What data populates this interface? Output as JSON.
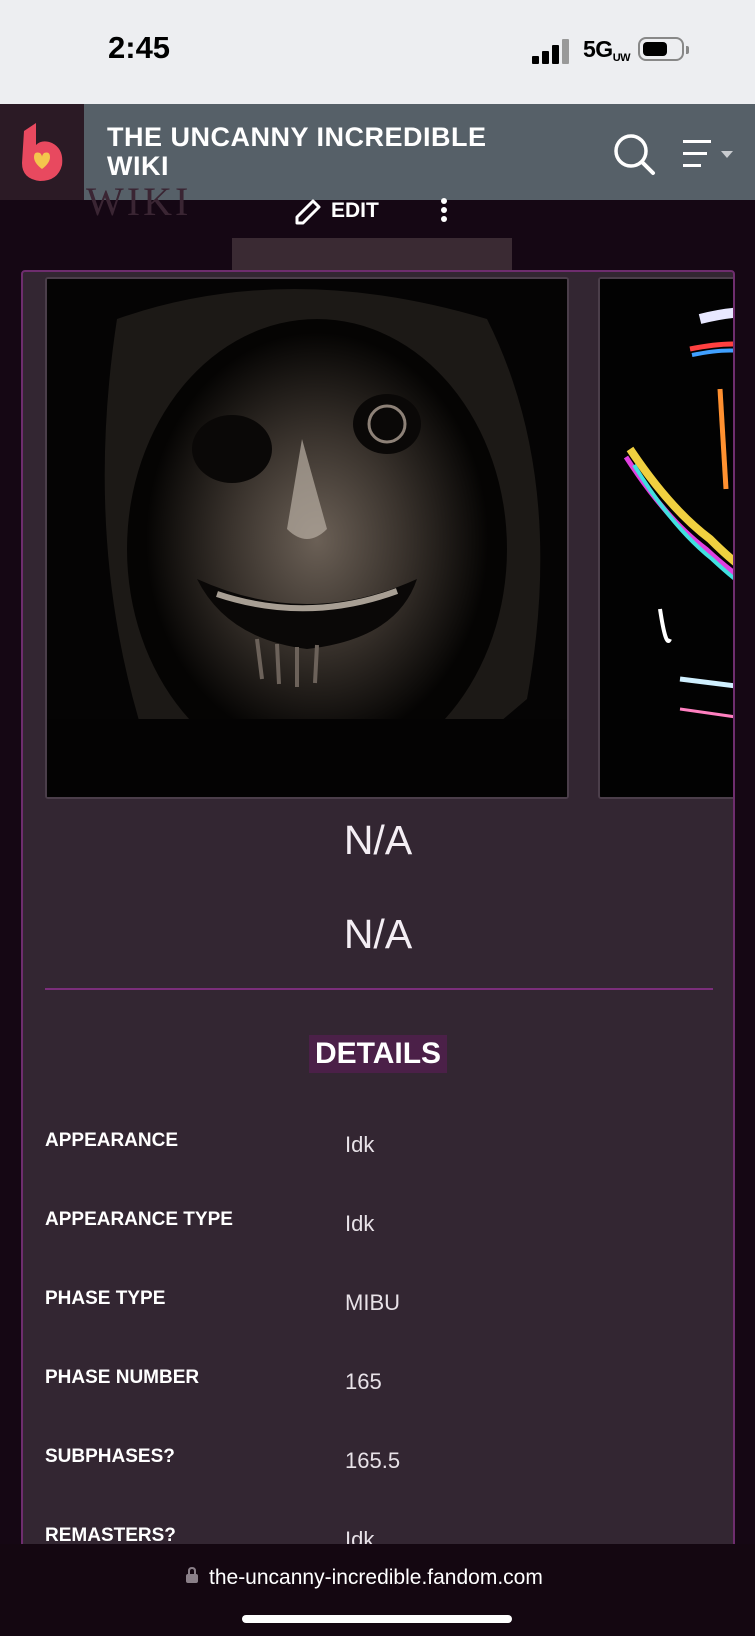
{
  "status_bar": {
    "time": "2:45",
    "network": "5G",
    "network_sub": "UW"
  },
  "header": {
    "wiki_title": "THE UNCANNY INCREDIBLE WIKI",
    "ghost_text": "WIKI"
  },
  "toolbar": {
    "edit_label": "EDIT"
  },
  "infobox": {
    "captions": [
      "N/A",
      "N/A"
    ],
    "section_title": "DETAILS",
    "rows": [
      {
        "label": "APPEARANCE",
        "value": "Idk"
      },
      {
        "label": "APPEARANCE TYPE",
        "value": "Idk"
      },
      {
        "label": "PHASE TYPE",
        "value": "MIBU"
      },
      {
        "label": "PHASE NUMBER",
        "value": "165"
      },
      {
        "label": "SUBPHASES?",
        "value": "165.5"
      },
      {
        "label": "REMASTERS?",
        "value": "Idk"
      }
    ]
  },
  "browser": {
    "url": "the-uncanny-incredible.fandom.com"
  },
  "colors": {
    "accent": "#7b2e7b",
    "header_bg": "#566068",
    "infobox_bg": "#332632",
    "fandom_logo": "#e8495f"
  }
}
